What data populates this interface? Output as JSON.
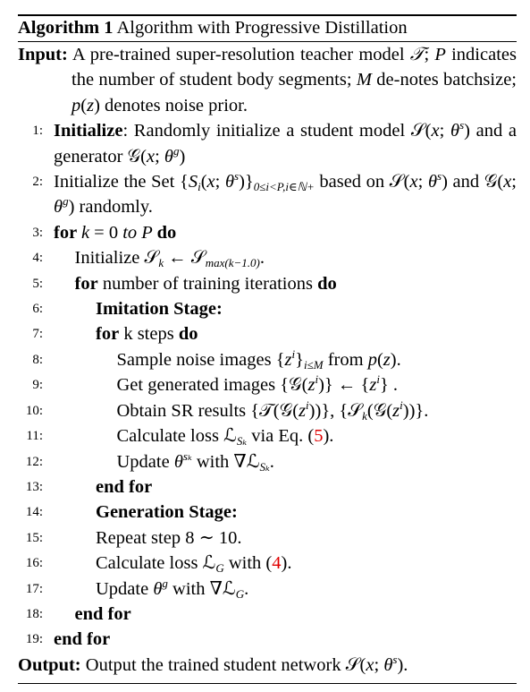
{
  "title": {
    "label": "Algorithm 1",
    "text": " Algorithm with Progressive Distillation"
  },
  "input": [
    {
      "t": "Input:",
      "c": "b"
    },
    {
      "t": "  A pre-trained super-resolution teacher model "
    },
    {
      "t": "𝒯",
      "c": "i"
    },
    {
      "t": "; "
    },
    {
      "t": "P",
      "c": "i"
    },
    {
      "t": " indicates the number of student body segments; "
    },
    {
      "t": "M",
      "c": "i"
    },
    {
      "t": " de-notes batchsize; "
    },
    {
      "t": "p",
      "c": "i"
    },
    {
      "t": "("
    },
    {
      "t": "z",
      "c": "i"
    },
    {
      "t": ") denotes noise prior."
    }
  ],
  "lines": [
    {
      "n": "1:",
      "indent": 0,
      "parts": [
        {
          "t": "Initialize",
          "c": "b"
        },
        {
          "t": ":  Randomly initialize a student model 𝒮("
        },
        {
          "t": "x",
          "c": "i"
        },
        {
          "t": "; "
        },
        {
          "t": "θ",
          "c": "i"
        },
        {
          "t": "s",
          "c": "sup"
        },
        {
          "t": ") and a generator 𝒢("
        },
        {
          "t": "x",
          "c": "i"
        },
        {
          "t": "; "
        },
        {
          "t": "θ",
          "c": "i"
        },
        {
          "t": "g",
          "c": "sup"
        },
        {
          "t": ")"
        }
      ]
    },
    {
      "n": "2:",
      "indent": 0,
      "parts": [
        {
          "t": "Initialize the Set {"
        },
        {
          "t": "S",
          "c": "i"
        },
        {
          "t": "i",
          "c": "sub"
        },
        {
          "t": "("
        },
        {
          "t": "x",
          "c": "i"
        },
        {
          "t": "; "
        },
        {
          "t": "θ",
          "c": "i"
        },
        {
          "t": "s",
          "c": "sup"
        },
        {
          "t": ")}"
        },
        {
          "t": "0≤i<P,i∈ℕ+",
          "c": "sub"
        },
        {
          "t": "  based on 𝒮("
        },
        {
          "t": "x",
          "c": "i"
        },
        {
          "t": "; "
        },
        {
          "t": "θ",
          "c": "i"
        },
        {
          "t": "s",
          "c": "sup"
        },
        {
          "t": ") and 𝒢("
        },
        {
          "t": "x",
          "c": "i"
        },
        {
          "t": "; "
        },
        {
          "t": "θ",
          "c": "i"
        },
        {
          "t": "g",
          "c": "sup"
        },
        {
          "t": ") randomly."
        }
      ]
    },
    {
      "n": "3:",
      "indent": 0,
      "parts": [
        {
          "t": "for ",
          "c": "b"
        },
        {
          "t": "k",
          "c": "i"
        },
        {
          "t": " = 0 "
        },
        {
          "t": "to P ",
          "c": "i"
        },
        {
          "t": "do",
          "c": "b"
        }
      ]
    },
    {
      "n": "4:",
      "indent": 1,
      "parts": [
        {
          "t": "Initialize 𝒮"
        },
        {
          "t": "k",
          "c": "sub"
        },
        {
          "t": " ← 𝒮"
        },
        {
          "t": "max(k−1.0)",
          "c": "sub"
        },
        {
          "t": "."
        }
      ]
    },
    {
      "n": "5:",
      "indent": 1,
      "parts": [
        {
          "t": "for",
          "c": "b"
        },
        {
          "t": " number of training iterations "
        },
        {
          "t": "do",
          "c": "b"
        }
      ]
    },
    {
      "n": "6:",
      "indent": 2,
      "parts": [
        {
          "t": "Imitation Stage:",
          "c": "b"
        }
      ]
    },
    {
      "n": "7:",
      "indent": 2,
      "parts": [
        {
          "t": "for",
          "c": "b"
        },
        {
          "t": " k steps "
        },
        {
          "t": "do",
          "c": "b"
        }
      ]
    },
    {
      "n": "8:",
      "indent": 3,
      "parts": [
        {
          "t": "Sample noise images {"
        },
        {
          "t": "z",
          "c": "i"
        },
        {
          "t": "i",
          "c": "sup"
        },
        {
          "t": "}"
        },
        {
          "t": "i≤M",
          "c": "sub"
        },
        {
          "t": " from "
        },
        {
          "t": "p",
          "c": "i"
        },
        {
          "t": "("
        },
        {
          "t": "z",
          "c": "i"
        },
        {
          "t": ")."
        }
      ]
    },
    {
      "n": "9:",
      "indent": 3,
      "parts": [
        {
          "t": "Get generated images {𝒢("
        },
        {
          "t": "z",
          "c": "i"
        },
        {
          "t": "i",
          "c": "sup"
        },
        {
          "t": ")} ← {"
        },
        {
          "t": "z",
          "c": "i"
        },
        {
          "t": "i",
          "c": "sup"
        },
        {
          "t": "} ."
        }
      ]
    },
    {
      "n": "10:",
      "indent": 3,
      "parts": [
        {
          "t": "Obtain SR results {𝒯(𝒢("
        },
        {
          "t": "z",
          "c": "i"
        },
        {
          "t": "i",
          "c": "sup"
        },
        {
          "t": "))}, {𝒮"
        },
        {
          "t": "k",
          "c": "sub"
        },
        {
          "t": "(𝒢("
        },
        {
          "t": "z",
          "c": "i"
        },
        {
          "t": "i",
          "c": "sup"
        },
        {
          "t": "))}."
        }
      ]
    },
    {
      "n": "11:",
      "indent": 3,
      "parts": [
        {
          "t": "Calculate loss ℒ"
        },
        {
          "t": "Sₖ",
          "c": "sub"
        },
        {
          "t": " via Eq. ("
        },
        {
          "t": "5",
          "c": "red"
        },
        {
          "t": ")."
        }
      ]
    },
    {
      "n": "12:",
      "indent": 3,
      "parts": [
        {
          "t": "Update "
        },
        {
          "t": "θ",
          "c": "i"
        },
        {
          "t": "sₖ",
          "c": "sup"
        },
        {
          "t": " with ∇ℒ"
        },
        {
          "t": "Sₖ",
          "c": "sub"
        },
        {
          "t": "."
        }
      ]
    },
    {
      "n": "13:",
      "indent": 2,
      "parts": [
        {
          "t": "end for",
          "c": "b"
        }
      ]
    },
    {
      "n": "14:",
      "indent": 2,
      "parts": [
        {
          "t": "Generation Stage:",
          "c": "b"
        }
      ]
    },
    {
      "n": "15:",
      "indent": 2,
      "parts": [
        {
          "t": "Repeat step 8 ∼ 10."
        }
      ]
    },
    {
      "n": "16:",
      "indent": 2,
      "parts": [
        {
          "t": "Calculate loss ℒ"
        },
        {
          "t": "G",
          "c": "sub"
        },
        {
          "t": " with ("
        },
        {
          "t": "4",
          "c": "red"
        },
        {
          "t": ")."
        }
      ]
    },
    {
      "n": "17:",
      "indent": 2,
      "parts": [
        {
          "t": "Update "
        },
        {
          "t": "θ",
          "c": "i"
        },
        {
          "t": "g",
          "c": "sup"
        },
        {
          "t": " with ∇ℒ"
        },
        {
          "t": "G",
          "c": "sub"
        },
        {
          "t": "."
        }
      ]
    },
    {
      "n": "18:",
      "indent": 1,
      "parts": [
        {
          "t": "end for",
          "c": "b"
        }
      ]
    },
    {
      "n": "19:",
      "indent": 0,
      "parts": [
        {
          "t": "end for",
          "c": "b"
        }
      ]
    }
  ],
  "output": [
    {
      "t": "Output:",
      "c": "b"
    },
    {
      "t": "  Output the trained student network 𝒮("
    },
    {
      "t": "x",
      "c": "i"
    },
    {
      "t": "; "
    },
    {
      "t": "θ",
      "c": "i"
    },
    {
      "t": "s",
      "c": "sup"
    },
    {
      "t": ")."
    }
  ],
  "colors": {
    "reference": "#e00000"
  }
}
